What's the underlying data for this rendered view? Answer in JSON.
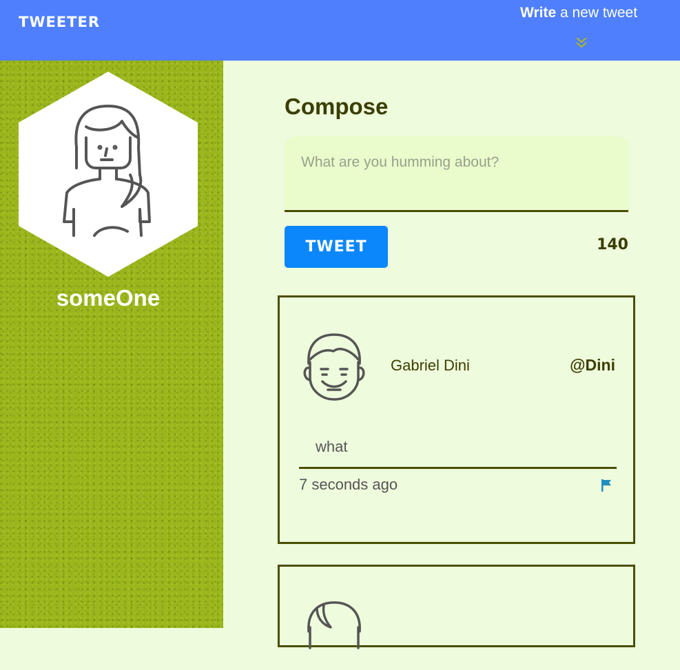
{
  "nav": {
    "brand": "TWEETER",
    "write_bold": "Write",
    "write_rest": " a new tweet"
  },
  "profile": {
    "username": "someOne"
  },
  "compose": {
    "title": "Compose",
    "placeholder": "What are you humming about?",
    "tweet_button": "TWEET",
    "counter": "140"
  },
  "tweets": [
    {
      "name": "Gabriel Dini",
      "handle": "@Dini",
      "text": "what",
      "time": "7 seconds ago"
    }
  ],
  "colors": {
    "nav": "#4f7ffc",
    "sidebar": "#9ab61c",
    "main_bg": "#eefbdc",
    "tweet_button": "#0b87fb",
    "dark_olive": "#3a3e00",
    "flag": "#1e8fc0"
  }
}
